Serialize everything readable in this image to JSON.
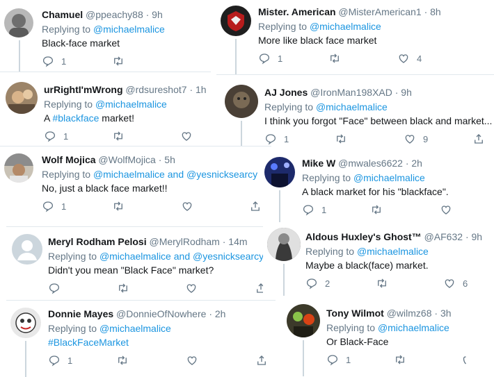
{
  "tweets": [
    {
      "name": "Chamuel",
      "handle": "@ppeachy88",
      "time": "· 9h",
      "reply_prefix": "Replying to",
      "mentions": [
        "@michaelmalice"
      ],
      "text": "Black-face market",
      "hashtag": "",
      "replies": "1",
      "likes": "",
      "avatar_color": "#b8b8b8"
    },
    {
      "name": "Mister. American",
      "handle": "@MisterAmerican1",
      "time": "· 8h",
      "reply_prefix": "Replying to",
      "mentions": [
        "@michaelmalice"
      ],
      "text": "More like black face market",
      "hashtag": "",
      "replies": "1",
      "likes": "4",
      "avatar_color": "#1f1f1f"
    },
    {
      "name": "urRightI'mWrong",
      "handle": "@rdsureshot7",
      "time": "· 1h",
      "reply_prefix": "Replying to",
      "mentions": [
        "@michaelmalice"
      ],
      "text_pre": "A ",
      "hashtag": "#blackface",
      "text_post": " market!",
      "replies": "1",
      "likes": "",
      "avatar_color": "#9c8468"
    },
    {
      "name": "AJ Jones",
      "handle": "@IronMan198XAD",
      "time": "· 9h",
      "reply_prefix": "Replying to",
      "mentions": [
        "@michaelmalice"
      ],
      "text": "I think you forgot \"Face\" between black and market...",
      "hashtag": "",
      "replies": "1",
      "likes": "9",
      "avatar_color": "#4a4036"
    },
    {
      "name": "Wolf Mojica",
      "handle": "@WolfMojica",
      "time": "· 5h",
      "reply_prefix": "Replying to",
      "mentions": [
        "@michaelmalice",
        "@yesnicksearcy"
      ],
      "and": "and",
      "text": "No, just a black face market!!",
      "hashtag": "",
      "replies": "1",
      "likes": "",
      "avatar_color": "#c9c2b5"
    },
    {
      "name": "Mike W",
      "handle": "@mwales6622",
      "time": "· 2h",
      "reply_prefix": "Replying to",
      "mentions": [
        "@michaelmalice"
      ],
      "text": "A black market for his \"blackface\".",
      "hashtag": "",
      "replies": "1",
      "likes": "",
      "avatar_color": "#1d2a6b"
    },
    {
      "name": "Meryl Rodham Pelosi",
      "handle": "@MerylRodham",
      "time": "· 14m",
      "reply_prefix": "Replying to",
      "mentions": [
        "@michaelmalice",
        "@yesnicksearcy"
      ],
      "and": "and",
      "text": "Didn't you mean \"Black Face\" market?",
      "hashtag": "",
      "replies": "",
      "likes": "",
      "avatar_color": "#ccd6dd"
    },
    {
      "name": "Aldous Huxley's Ghost™",
      "handle": "@AF632",
      "time": "· 9h",
      "reply_prefix": "Replying to",
      "mentions": [
        "@michaelmalice"
      ],
      "text": "Maybe a black(face) market.",
      "hashtag": "",
      "replies": "2",
      "likes": "6",
      "avatar_color": "#5a5a5a"
    },
    {
      "name": "Donnie Mayes",
      "handle": "@DonnieOfNowhere",
      "time": "· 2h",
      "reply_prefix": "Replying to",
      "mentions": [
        "@michaelmalice"
      ],
      "text": "",
      "hashtag": "#BlackFaceMarket",
      "replies": "1",
      "likes": "",
      "avatar_color": "#e8e8e8"
    },
    {
      "name": "Tony Wilmot",
      "handle": "@wilmz68",
      "time": "· 3h",
      "reply_prefix": "Replying to",
      "mentions": [
        "@michaelmalice"
      ],
      "text": "Or Black-Face",
      "hashtag": "",
      "replies": "1",
      "likes": "",
      "avatar_color": "#3c3a2a"
    }
  ]
}
